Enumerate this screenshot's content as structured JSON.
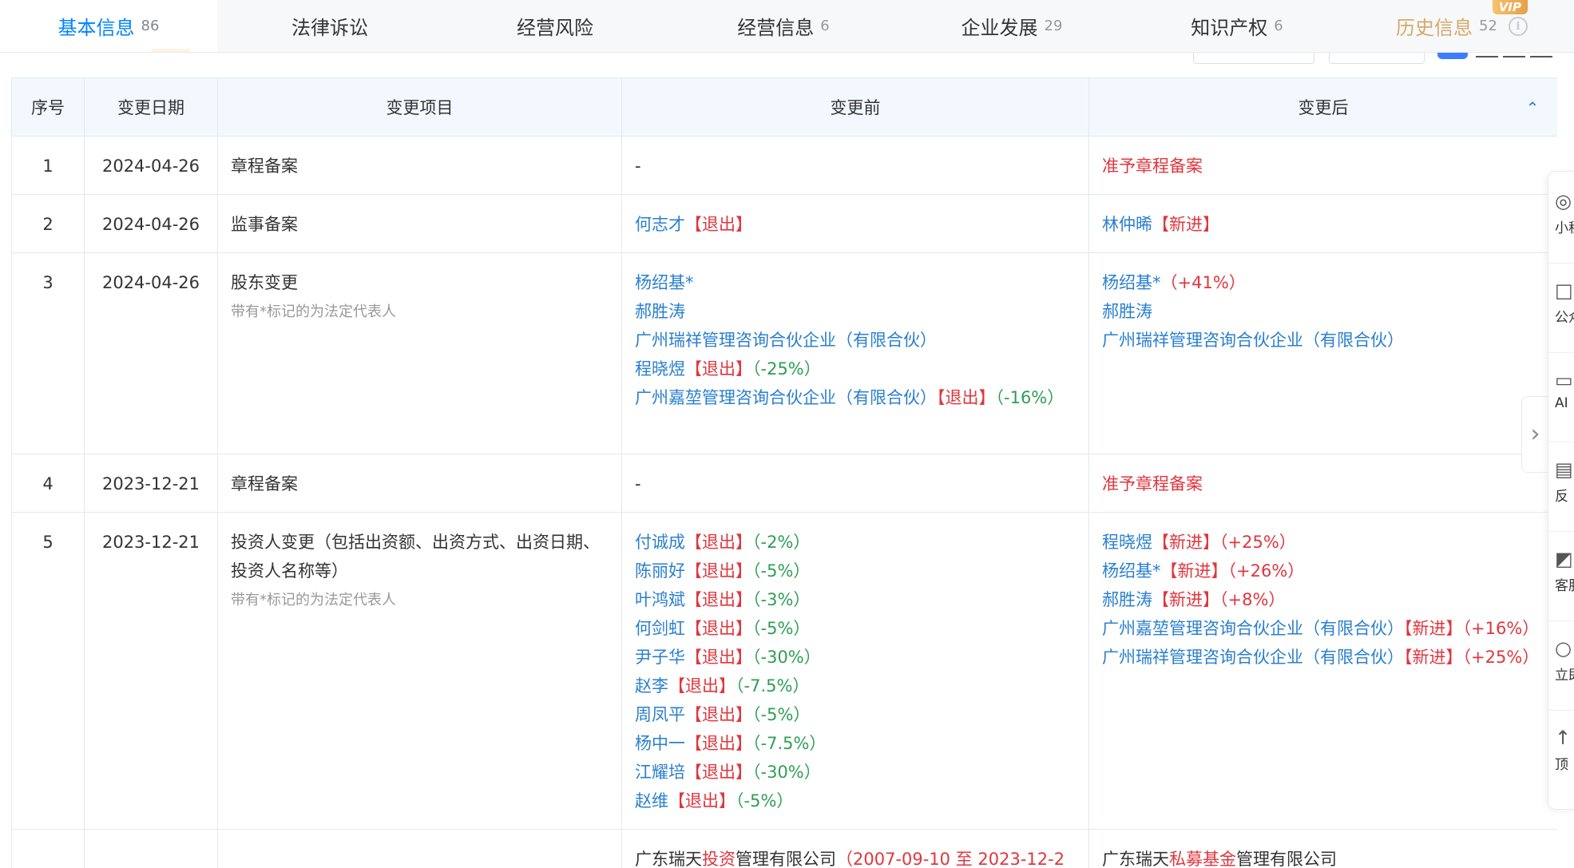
{
  "tabs": [
    {
      "label": "基本信息",
      "count": "86",
      "active": true
    },
    {
      "label": "法律诉讼",
      "count": ""
    },
    {
      "label": "经营风险",
      "count": ""
    },
    {
      "label": "经营信息",
      "count": "6"
    },
    {
      "label": "企业发展",
      "count": "29"
    },
    {
      "label": "知识产权",
      "count": "6"
    },
    {
      "label": "历史信息",
      "count": "52",
      "badge": "VIP"
    }
  ],
  "table": {
    "headers": [
      "序号",
      "变更日期",
      "变更项目",
      "变更前",
      "变更后"
    ],
    "note_legal_rep": "带有*标记的为法定代表人",
    "rows": [
      {
        "no": "1",
        "date": "2024-04-26",
        "item": "章程备案",
        "before": "-",
        "after": "准予章程备案"
      },
      {
        "no": "2",
        "date": "2024-04-26",
        "item": "监事备案",
        "before": {
          "name": "何志才",
          "tag": "【退出】"
        },
        "after": {
          "name": "林仲晞",
          "tag": "【新进】"
        }
      },
      {
        "no": "3",
        "date": "2024-04-26",
        "item": "股东变更",
        "before": [
          {
            "name": "杨绍基*"
          },
          {
            "name": "郝胜涛"
          },
          {
            "name": "广州瑞祥管理咨询合伙企业（有限合伙）"
          },
          {
            "name": "程晓煜",
            "tag": "【退出】",
            "pct": "（-25%）"
          },
          {
            "name": "广州嘉堃管理咨询合伙企业（有限合伙）",
            "tag": "【退出】",
            "pct": "（-16%）"
          }
        ],
        "after": [
          {
            "name": "杨绍基*",
            "pct": "（+41%）"
          },
          {
            "name": "郝胜涛"
          },
          {
            "name": "广州瑞祥管理咨询合伙企业（有限合伙）"
          }
        ]
      },
      {
        "no": "4",
        "date": "2023-12-21",
        "item": "章程备案",
        "before": "-",
        "after": "准予章程备案"
      },
      {
        "no": "5",
        "date": "2023-12-21",
        "item": "投资人变更（包括出资额、出资方式、出资日期、投资人名称等）",
        "before": [
          {
            "name": "付诚成",
            "tag": "【退出】",
            "pct": "（-2%）"
          },
          {
            "name": "陈丽好",
            "tag": "【退出】",
            "pct": "（-5%）"
          },
          {
            "name": "叶鸿斌",
            "tag": "【退出】",
            "pct": "（-3%）"
          },
          {
            "name": "何剑虹",
            "tag": "【退出】",
            "pct": "（-5%）"
          },
          {
            "name": "尹子华",
            "tag": "【退出】",
            "pct": "（-30%）"
          },
          {
            "name": "赵李",
            "tag": "【退出】",
            "pct": "（-7.5%）"
          },
          {
            "name": "周凤平",
            "tag": "【退出】",
            "pct": "（-5%）"
          },
          {
            "name": "杨中一",
            "tag": "【退出】",
            "pct": "（-7.5%）"
          },
          {
            "name": "江耀培",
            "tag": "【退出】",
            "pct": "（-30%）"
          },
          {
            "name": "赵维",
            "tag": "【退出】",
            "pct": "（-5%）"
          }
        ],
        "after": [
          {
            "name": "程晓煜",
            "tag": "【新进】",
            "pct": "（+25%）"
          },
          {
            "name": "杨绍基*",
            "tag": "【新进】",
            "pct": "（+26%）"
          },
          {
            "name": "郝胜涛",
            "tag": "【新进】",
            "pct": "（+8%）"
          },
          {
            "name": "广州嘉堃管理咨询合伙企业（有限合伙）",
            "tag": "【新进】",
            "pct": "（+16%）"
          },
          {
            "name": "广州瑞祥管理咨询合伙企业（有限合伙）",
            "tag": "【新进】",
            "pct": "（+25%）"
          }
        ]
      },
      {
        "no": "",
        "date": "",
        "item": "",
        "before": {
          "prefix": "广东瑞天",
          "hl": "投资",
          "suffix": "管理有限公司",
          "period": "（2007-09-10 至 2023-12-2"
        },
        "after": {
          "prefix": "广东瑞天",
          "hl": "私募基金",
          "suffix": "管理有限公司"
        }
      }
    ]
  },
  "side_rail": [
    "小程",
    "公众",
    "AI",
    "反",
    "客服",
    "立即",
    "顶"
  ],
  "colors": {
    "accent": "#0084ff",
    "link": "#2a7fcf",
    "red": "#e0363d",
    "green": "#2e9e55",
    "gold": "#d7a96a"
  }
}
